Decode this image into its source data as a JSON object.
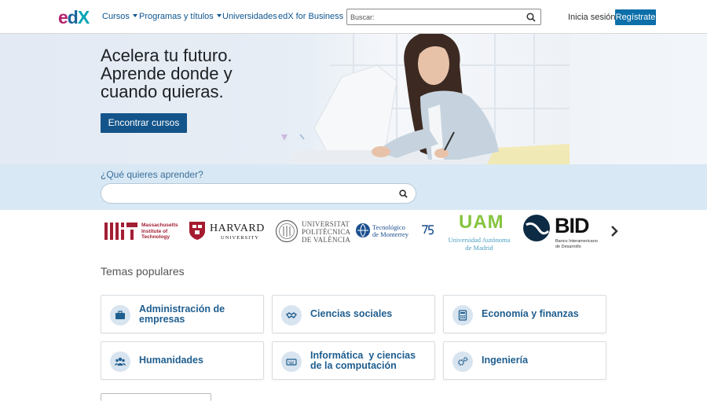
{
  "header": {
    "logo": {
      "e": "e",
      "d": "d",
      "x": "X"
    },
    "nav": [
      {
        "label": "Cursos",
        "has_caret": true
      },
      {
        "label": "Programas y títulos",
        "has_caret": true
      },
      {
        "label": "Universidades",
        "has_caret": false
      },
      {
        "label": "edX for Business",
        "has_caret": false
      }
    ],
    "search_placeholder": "Buscar:",
    "signin": "Inicia sesión",
    "register": "Regístrate"
  },
  "hero": {
    "title_line1": "Acelera tu futuro.",
    "title_line2": "Aprende donde y",
    "title_line3": "cuando quieras.",
    "cta": "Encontrar cursos"
  },
  "learn": {
    "question": "¿Qué quieres aprender?",
    "placeholder": ""
  },
  "partners": {
    "mit": {
      "l1": "Massachusetts",
      "l2": "Institute of",
      "l3": "Technology"
    },
    "harvard": {
      "l1": "HARVARD",
      "l2": "UNIVERSITY"
    },
    "upv": {
      "l1": "UNIVERSITAT",
      "l2": "POLITÈCNICA",
      "l3": "DE VALÈNCIA"
    },
    "tec": {
      "l1": "Tecnológico",
      "l2": "de Monterrey"
    },
    "uam": {
      "abbr": "UAM",
      "l1": "Universidad Autónoma",
      "l2": "de Madrid"
    },
    "bid": {
      "abbr": "BID",
      "l1": "Banco Interamericano",
      "l2": "de Desarrollo"
    }
  },
  "topics": {
    "title": "Temas populares",
    "items": [
      {
        "l1": "Administración de",
        "l2": "empresas",
        "icon": "briefcase-icon"
      },
      {
        "l1": "Ciencias sociales",
        "l2": "",
        "icon": "handshake-icon"
      },
      {
        "l1": "Economía y finanzas",
        "l2": "",
        "icon": "calculator-icon"
      },
      {
        "l1": "Humanidades",
        "l2": "",
        "icon": "people-icon"
      },
      {
        "l1": "Informática  y ciencias",
        "l2": "de la computación",
        "icon": "keyboard-icon"
      },
      {
        "l1": "Ingeniería",
        "l2": "",
        "icon": "gears-icon"
      }
    ]
  },
  "colors": {
    "brand_blue": "#0d6fa9",
    "cta": "#13548a",
    "link": "#0e5590",
    "light_band": "#d8e8f4"
  }
}
